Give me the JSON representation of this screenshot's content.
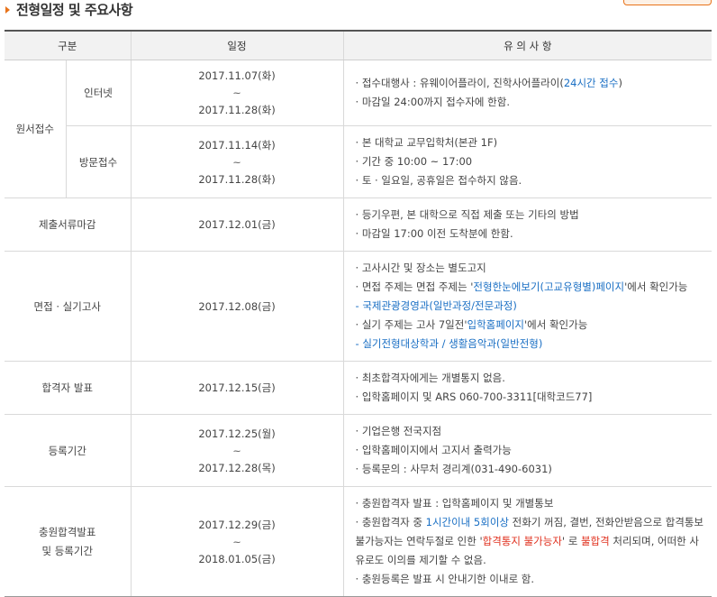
{
  "heading": {
    "title": "전형일정 및 주요사항"
  },
  "table": {
    "headers": {
      "category": "구분",
      "schedule": "일정",
      "notes": "유 의 사 항"
    },
    "application": {
      "label": "원서접수",
      "online": {
        "label": "인터넷",
        "date_start": "2017.11.07(화)",
        "tilde": "~",
        "date_end": "2017.11.28(화)",
        "notes": {
          "line1_a": "· 접수대행사 : 유웨이어플라이, 진학사어플라이(",
          "line1_b": "24시간 접수",
          "line1_c": ")",
          "line2": "· 마감일 24:00까지 접수자에 한함."
        }
      },
      "visit": {
        "label": "방문접수",
        "date_start": "2017.11.14(화)",
        "tilde": "~",
        "date_end": "2017.11.28(화)",
        "notes": {
          "line1": "· 본 대학교 교무입학처(본관 1F)",
          "line2": "· 기간 중 10:00 ~ 17:00",
          "line3": "· 토 · 일요일, 공휴일은 접수하지 않음."
        }
      }
    },
    "documents": {
      "label": "제출서류마감",
      "date": "2017.12.01(금)",
      "notes": {
        "line1": "· 등기우편, 본 대학으로 직접 제출 또는 기타의 방법",
        "line2": "· 마감일 17:00 이전 도착분에 한함."
      }
    },
    "interview": {
      "label": "면접 · 실기고사",
      "date": "2017.12.08(금)",
      "notes": {
        "line1": "· 고사시간 및 장소는 별도고지",
        "line2_a": "· 면접 주제는 면접 주제는 '",
        "line2_b": "전형한눈에보기(고교유형별)페이지",
        "line2_c": "'에서 확인가능",
        "line3": "- 국제관광경영과(일반과정/전문과정)",
        "line4_a": "· 실기 주제는 고사 7일전'",
        "line4_b": "입학홈페이지",
        "line4_c": "'에서 확인가능",
        "line5": "- 실기전형대상학과 / 생활음악과(일반전형)"
      }
    },
    "announcement": {
      "label": "합격자 발표",
      "date": "2017.12.15(금)",
      "notes": {
        "line1": "· 최초합격자에게는 개별통지 없음.",
        "line2": "· 입학홈페이지 및 ARS 060-700-3311[대학코드77]"
      }
    },
    "registration": {
      "label": "등록기간",
      "date_start": "2017.12.25(월)",
      "tilde": "~",
      "date_end": "2017.12.28(목)",
      "notes": {
        "line1": "· 기업은행 전국지점",
        "line2": "· 입학홈페이지에서 고지서 출력가능",
        "line3": "· 등록문의 : 사무처 경리계(031-490-6031)"
      }
    },
    "additional": {
      "label_line1": "충원합격발표",
      "label_line2": "및 등록기간",
      "date_start": "2017.12.29(금)",
      "tilde": "~",
      "date_end": "2018.01.05(금)",
      "notes": {
        "line1": "· 충원합격자 발표 : 입학홈페이지 및 개별통보",
        "p2_a": "· 충원합격자 중 ",
        "p2_b": "1시간이내 5회이상",
        "p2_c": " 전화기 꺼짐, 결번, 전화안받음으로 합격통보 불가능자는 연락두절로 인한 '",
        "p2_d": "합격통지 불가능자",
        "p2_e": "' 로 ",
        "p2_f": "불합격",
        "p2_g": " 처리되며, 어떠한 사유로도 이의를 제기할 수 없음.",
        "line4": "· 충원등록은 발표 시 안내기한 이내로 함."
      }
    }
  },
  "colors": {
    "accent": "#e8731a",
    "link": "#1a6fc4",
    "warning": "#e0301e",
    "header_bg": "#f2f2f2"
  }
}
